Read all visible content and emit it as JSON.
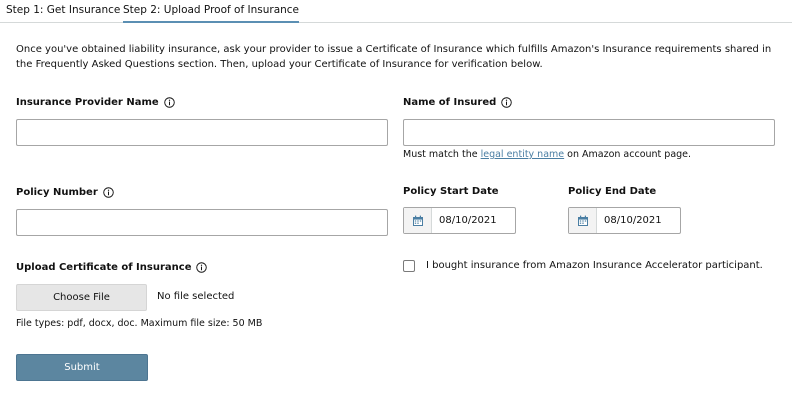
{
  "tabs": [
    {
      "label": "Step 1: Get Insurance"
    },
    {
      "label": "Step 2: Upload Proof of Insurance"
    }
  ],
  "intro": "Once you've obtained liability insurance, ask your provider to issue a Certificate of Insurance which fulfills Amazon's Insurance requirements shared in the Frequently Asked Questions section. Then, upload your Certificate of Insurance for verification below.",
  "form": {
    "provider_label": "Insurance Provider Name",
    "insured_label": "Name of Insured",
    "insured_hint_pre": "Must match the ",
    "insured_hint_link": "legal entity name",
    "insured_hint_post": " on Amazon account page.",
    "policy_label": "Policy Number",
    "start_label": "Policy Start Date",
    "start_value": "08/10/2021",
    "end_label": "Policy End Date",
    "end_value": "08/10/2021",
    "upload_label": "Upload Certificate of Insurance",
    "choose_file": "Choose File",
    "no_file": "No file selected",
    "file_types": "File types: pdf, docx, doc. Maximum file size: 50 MB",
    "checkbox_label": "I bought insurance from Amazon Insurance Accelerator participant.",
    "submit": "Submit"
  },
  "icons": {
    "info": "info-circle-icon",
    "calendar": "calendar-icon"
  },
  "colors": {
    "accent": "#5b8fb3",
    "submit_bg": "#5c86a0",
    "link": "#4a7ea3"
  }
}
